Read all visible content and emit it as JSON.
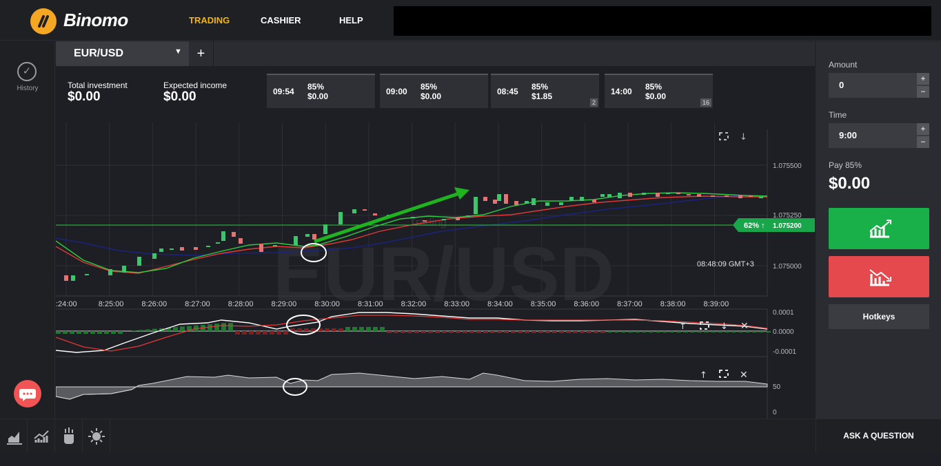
{
  "app": {
    "name": "Binomo"
  },
  "nav": {
    "trading": "TRADING",
    "cashier": "CASHIER",
    "help": "HELP"
  },
  "sidebar": {
    "history_label": "History"
  },
  "tab": {
    "asset": "EUR/USD",
    "add": "+"
  },
  "summary": {
    "total_investment_label": "Total investment",
    "total_investment_value": "$0.00",
    "expected_income_label": "Expected income",
    "expected_income_value": "$0.00"
  },
  "deals": [
    {
      "time": "09:54",
      "pct": "85%",
      "amount": "$0.00",
      "badge": ""
    },
    {
      "time": "09:00",
      "pct": "85%",
      "amount": "$0.00",
      "badge": ""
    },
    {
      "time": "08:45",
      "pct": "85%",
      "amount": "$1.85",
      "badge": "2"
    },
    {
      "time": "14:00",
      "pct": "85%",
      "amount": "$0.00",
      "badge": "16"
    }
  ],
  "chart": {
    "watermark": "EUR/USD",
    "watermark_sub": "Trading",
    "price_levels": [
      "1.075500",
      "1.075250",
      "1.075000"
    ],
    "current_price_tag": "62% ↑",
    "current_price": "1.075200",
    "clock": "08:48:09 GMT+3",
    "time_ticks": [
      ":24:00",
      "8:25:00",
      "8:26:00",
      "8:27:00",
      "8:28:00",
      "8:29:00",
      "8:30:00",
      "8:31:00",
      "8:32:00",
      "8:33:00",
      "8:34:00",
      "8:35:00",
      "8:36:00",
      "8:37:00",
      "8:38:00",
      "8:39:00"
    ],
    "macd_levels": [
      "0.0001",
      "0.0000",
      "-0.0001"
    ],
    "rsi_levels": [
      "50",
      "0"
    ],
    "colors": {
      "up": "#3ec46d",
      "down": "#e57373",
      "ma_red": "#e53935",
      "ma_green": "#2ecc40",
      "ma_blue": "#1a237e",
      "arrow": "#1fb31f"
    }
  },
  "panel": {
    "amount_label": "Amount",
    "amount_value": "0",
    "time_label": "Time",
    "time_value": "9:00",
    "pay_label": "Pay 85%",
    "pay_value": "$0.00",
    "hotkeys": "Hotkeys",
    "step_plus": "+",
    "step_minus": "−"
  },
  "bottom": {
    "ask": "ASK A QUESTION"
  }
}
